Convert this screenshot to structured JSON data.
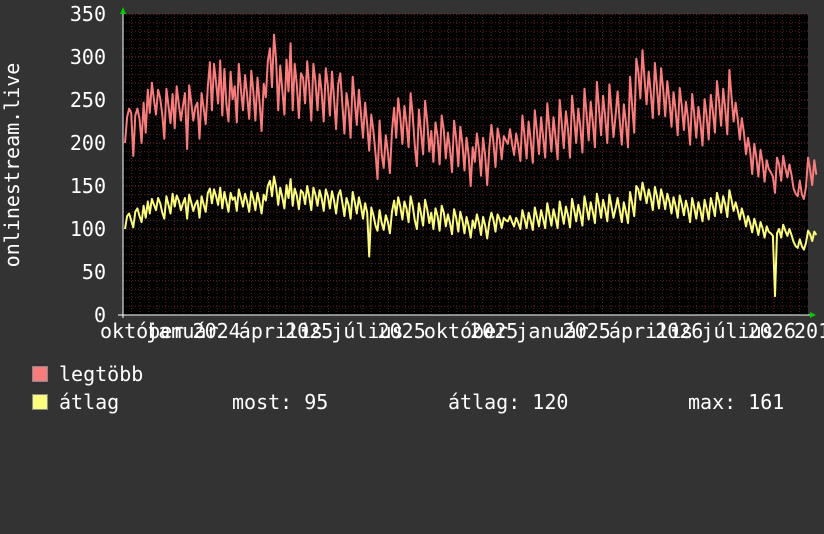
{
  "chart_data": {
    "type": "line",
    "ylabel": "onlinestream.live",
    "ylim": [
      0,
      350
    ],
    "yticks": [
      "0",
      "50",
      "100",
      "150",
      "200",
      "250",
      "300",
      "350"
    ],
    "xtick_labels": [
      "október",
      "január",
      "2024",
      "április",
      "2025",
      "július",
      "2025",
      "október",
      "2025",
      "január",
      "2025",
      "április",
      "2026",
      "július",
      "2026",
      "201"
    ],
    "x_count": 330,
    "grid": true,
    "series": [
      {
        "name": "legtöbb",
        "color": "#f87c7c",
        "values": [
          200,
          230,
          240,
          235,
          185,
          232,
          240,
          228,
          200,
          247,
          212,
          262,
          235,
          270,
          250,
          233,
          262,
          252,
          233,
          205,
          263,
          243,
          223,
          257,
          217,
          266,
          245,
          226,
          244,
          258,
          193,
          267,
          248,
          226,
          242,
          247,
          205,
          258,
          240,
          222,
          265,
          294,
          238,
          292,
          270,
          246,
          296,
          232,
          286,
          245,
          225,
          283,
          251,
          266,
          224,
          292,
          262,
          238,
          279,
          256,
          228,
          284,
          260,
          226,
          276,
          248,
          214,
          269,
          253,
          295,
          310,
          265,
          326,
          296,
          238,
          290,
          262,
          233,
          297,
          260,
          316,
          238,
          292,
          268,
          229,
          281,
          276,
          246,
          295,
          266,
          226,
          292,
          272,
          238,
          280,
          260,
          225,
          287,
          266,
          232,
          283,
          251,
          216,
          268,
          281,
          246,
          211,
          258,
          240,
          206,
          277,
          248,
          221,
          262,
          233,
          206,
          247,
          222,
          191,
          233,
          214,
          188,
          158,
          226,
          187,
          171,
          209,
          189,
          165,
          214,
          241,
          206,
          252,
          230,
          199,
          243,
          223,
          195,
          258,
          232,
          197,
          173,
          239,
          213,
          187,
          249,
          225,
          190,
          214,
          178,
          224,
          207,
          175,
          232,
          215,
          182,
          212,
          192,
          166,
          226,
          205,
          173,
          219,
          199,
          168,
          206,
          186,
          150,
          195,
          178,
          211,
          192,
          162,
          206,
          185,
          151,
          194,
          221,
          201,
          172,
          217,
          204,
          181,
          208,
          203,
          199,
          216,
          199,
          186,
          211,
          197,
          179,
          232,
          209,
          182,
          225,
          203,
          177,
          238,
          214,
          187,
          230,
          207,
          183,
          246,
          218,
          190,
          230,
          207,
          181,
          250,
          222,
          194,
          237,
          216,
          183,
          255,
          228,
          200,
          240,
          218,
          189,
          263,
          233,
          203,
          248,
          224,
          195,
          271,
          240,
          209,
          255,
          230,
          200,
          268,
          238,
          207,
          232,
          260,
          226,
          198,
          245,
          224,
          195,
          277,
          244,
          212,
          298,
          283,
          252,
          308,
          275,
          245,
          283,
          258,
          229,
          293,
          264,
          233,
          287,
          262,
          231,
          272,
          249,
          219,
          259,
          238,
          209,
          264,
          243,
          215,
          248,
          229,
          198,
          257,
          234,
          206,
          242,
          224,
          197,
          251,
          232,
          204,
          256,
          236,
          212,
          272,
          248,
          220,
          263,
          239,
          210,
          285,
          254,
          225,
          247,
          228,
          204,
          229,
          212,
          187,
          206,
          191,
          164,
          199,
          184,
          161,
          192,
          178,
          155,
          180,
          170,
          166,
          161,
          142,
          183,
          175,
          156,
          185,
          171,
          160,
          175,
          163,
          147,
          141,
          138,
          156,
          140,
          135,
          149,
          183,
          169,
          151,
          180,
          163
        ]
      },
      {
        "name": "átlag",
        "color": "#fcfc7c",
        "values": [
          100,
          115,
          118,
          110,
          102,
          120,
          124,
          115,
          108,
          127,
          113,
          132,
          118,
          135,
          128,
          122,
          136,
          130,
          119,
          112,
          138,
          128,
          118,
          141,
          126,
          139,
          133,
          122,
          130,
          136,
          112,
          140,
          131,
          121,
          129,
          133,
          113,
          138,
          128,
          120,
          142,
          147,
          130,
          146,
          138,
          128,
          148,
          124,
          143,
          132,
          120,
          142,
          134,
          137,
          121,
          146,
          136,
          126,
          141,
          132,
          120,
          144,
          135,
          122,
          142,
          131,
          118,
          140,
          133,
          150,
          156,
          138,
          161,
          149,
          128,
          148,
          137,
          124,
          151,
          136,
          158,
          127,
          147,
          139,
          123,
          145,
          142,
          129,
          150,
          138,
          122,
          148,
          140,
          127,
          145,
          136,
          121,
          146,
          138,
          124,
          144,
          133,
          118,
          139,
          145,
          131,
          115,
          136,
          128,
          112,
          143,
          131,
          118,
          137,
          126,
          112,
          130,
          119,
          68,
          125,
          116,
          104,
          98,
          122,
          107,
          99,
          116,
          108,
          95,
          120,
          133,
          116,
          137,
          126,
          111,
          132,
          124,
          108,
          138,
          127,
          110,
          100,
          130,
          118,
          104,
          134,
          123,
          107,
          119,
          100,
          124,
          115,
          98,
          127,
          119,
          103,
          117,
          107,
          94,
          123,
          113,
          97,
          120,
          110,
          95,
          114,
          104,
          90,
          110,
          101,
          117,
          107,
          93,
          114,
          104,
          89,
          108,
          119,
          111,
          97,
          117,
          111,
          101,
          113,
          110,
          109,
          115,
          108,
          103,
          113,
          107,
          100,
          122,
          112,
          101,
          119,
          110,
          99,
          125,
          114,
          103,
          122,
          112,
          101,
          130,
          117,
          104,
          123,
          113,
          101,
          132,
          119,
          106,
          126,
          116,
          102,
          135,
          122,
          109,
          128,
          117,
          104,
          138,
          125,
          111,
          131,
          120,
          107,
          141,
          128,
          113,
          134,
          123,
          109,
          140,
          127,
          113,
          124,
          136,
          122,
          108,
          131,
          120,
          107,
          143,
          130,
          115,
          150,
          146,
          134,
          154,
          143,
          130,
          146,
          136,
          122,
          149,
          138,
          124,
          146,
          136,
          123,
          141,
          132,
          118,
          137,
          127,
          113,
          139,
          129,
          116,
          133,
          123,
          108,
          136,
          125,
          112,
          131,
          122,
          109,
          134,
          124,
          111,
          136,
          126,
          115,
          142,
          132,
          119,
          138,
          128,
          114,
          145,
          134,
          121,
          131,
          122,
          111,
          124,
          115,
          103,
          115,
          107,
          96,
          112,
          104,
          93,
          108,
          101,
          90,
          103,
          97,
          95,
          92,
          22,
          95,
          100,
          90,
          105,
          98,
          92,
          100,
          93,
          85,
          80,
          78,
          88,
          80,
          76,
          84,
          98,
          94,
          86,
          97,
          93
        ]
      }
    ]
  },
  "legend": {
    "items": [
      {
        "label": "legtöbb",
        "color": "#f87c7c"
      },
      {
        "label": "átlag",
        "color": "#fcfc7c"
      }
    ],
    "stats": {
      "now": "most: 95",
      "avg": "átlag: 120",
      "max": "max: 161"
    }
  }
}
